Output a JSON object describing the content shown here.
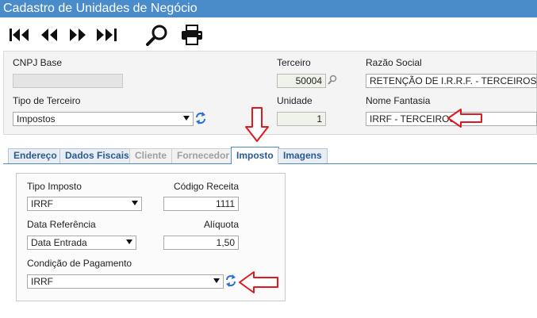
{
  "window": {
    "title": "Cadastro de Unidades de Negócio"
  },
  "toolbar": {
    "first": "first-record-icon",
    "prev": "previous-record-icon",
    "next": "next-record-icon",
    "last": "last-record-icon",
    "search": "search-icon",
    "print": "printer-icon"
  },
  "header_form": {
    "cnpj_label": "CNPJ Base",
    "cnpj_value": "",
    "terceiro_label": "Terceiro",
    "terceiro_value": "50004",
    "razao_label": "Razão Social",
    "razao_value": "RETENÇÃO DE I.R.R.F. - TERCEIROS",
    "tipo_label": "Tipo de Terceiro",
    "tipo_value": "Impostos",
    "unidade_label": "Unidade",
    "unidade_value": "1",
    "fantasia_label": "Nome Fantasia",
    "fantasia_value": "IRRF - TERCEIROS"
  },
  "tabs": [
    {
      "label": "Endereço",
      "state": "normal"
    },
    {
      "label": "Dados Fiscais",
      "state": "normal"
    },
    {
      "label": "Cliente",
      "state": "disabled"
    },
    {
      "label": "Fornecedor",
      "state": "disabled"
    },
    {
      "label": "Imposto",
      "state": "active"
    },
    {
      "label": "Imagens",
      "state": "normal"
    }
  ],
  "imposto_panel": {
    "tipo_label": "Tipo Imposto",
    "tipo_value": "IRRF",
    "codigo_label": "Código Receita",
    "codigo_value": "1111",
    "dataref_label": "Data Referência",
    "dataref_value": "Data Entrada",
    "aliquota_label": "Alíquota",
    "aliquota_value": "1,50",
    "condicao_label": "Condição de Pagamento",
    "condicao_value": "IRRF"
  },
  "colors": {
    "title_bar": "#4a8bc9",
    "annotation_arrow": "#e0191f",
    "tab_text": "#2a5a8f"
  }
}
